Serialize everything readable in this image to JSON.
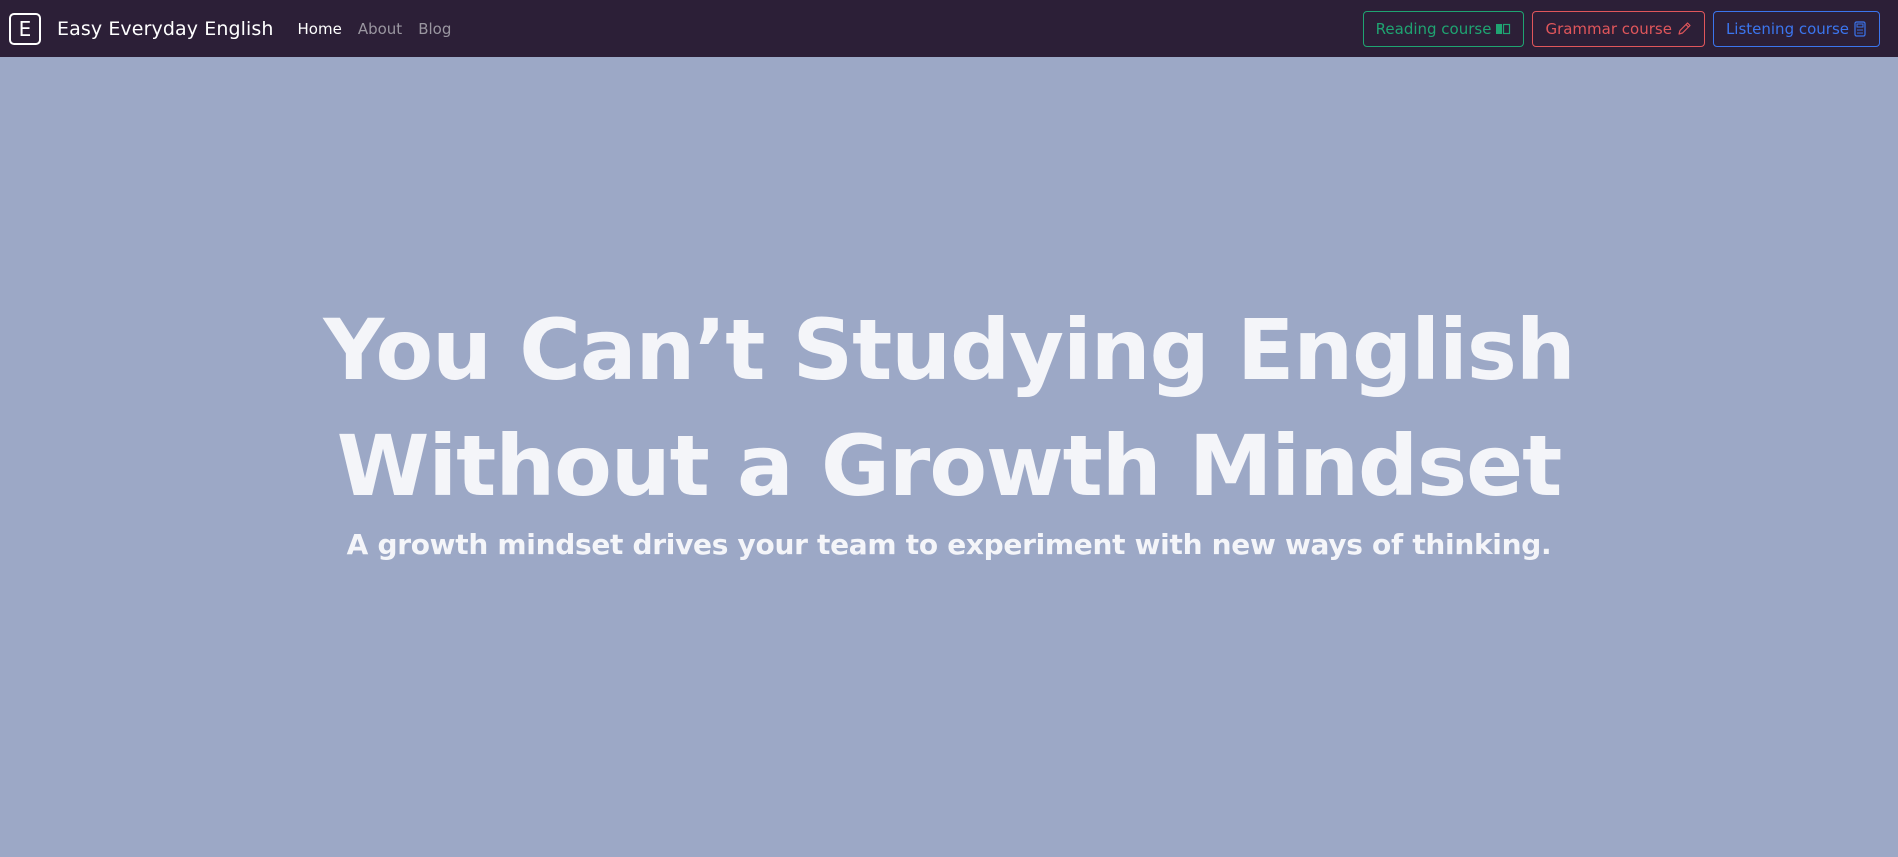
{
  "brand": {
    "logo_letter": "E",
    "name": "Easy Everyday English"
  },
  "nav": {
    "links": [
      {
        "label": "Home",
        "active": true
      },
      {
        "label": "About",
        "active": false
      },
      {
        "label": "Blog",
        "active": false
      }
    ]
  },
  "courses": {
    "reading": {
      "label": "Reading course",
      "icon": "book-icon",
      "color": "#1fa472"
    },
    "grammar": {
      "label": "Grammar course",
      "icon": "pencil-icon",
      "color": "#e0565b"
    },
    "listening": {
      "label": "Listening course",
      "icon": "calculator-icon",
      "color": "#3b75ee"
    }
  },
  "hero": {
    "title_line1": "You Can’t Studying English",
    "title_line2": "Without a Growth Mindset",
    "subtitle": "A growth mindset drives your team to experiment with new ways of thinking."
  },
  "colors": {
    "navbar_bg": "#2c1f37",
    "page_bg": "#9ca8c6",
    "hero_text": "#f4f5f9"
  }
}
